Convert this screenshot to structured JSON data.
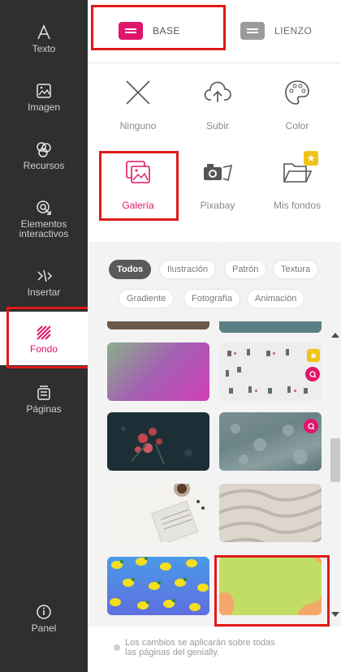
{
  "sidebar": {
    "items": [
      {
        "label": "Texto",
        "icon": "text-icon"
      },
      {
        "label": "Imagen",
        "icon": "image-icon"
      },
      {
        "label": "Recursos",
        "icon": "resources-icon"
      },
      {
        "label": "Elementos interactivos",
        "icon": "interactive-icon"
      },
      {
        "label": "Insertar",
        "icon": "insert-icon"
      },
      {
        "label": "Fondo",
        "icon": "background-icon"
      },
      {
        "label": "Páginas",
        "icon": "pages-icon"
      }
    ],
    "panel_label": "Panel",
    "active_index": 5
  },
  "tabs": {
    "base": "BASE",
    "lienzo": "LIENZO"
  },
  "options": {
    "row1": [
      "Ninguno",
      "Subir",
      "Color"
    ],
    "row2": [
      "Galería",
      "Pixabay",
      "Mis fondos"
    ]
  },
  "filters": [
    "Todos",
    "Ilustración",
    "Patrón",
    "Textura",
    "Gradiente",
    "Fotografía",
    "Animación"
  ],
  "note": "Los cambios se aplicarán sobre todas las páginas del genially.",
  "colors": {
    "accent": "#e0156a",
    "sidebar_bg": "#2f2f2f",
    "highlight": "#e01919",
    "star": "#f2c318"
  }
}
